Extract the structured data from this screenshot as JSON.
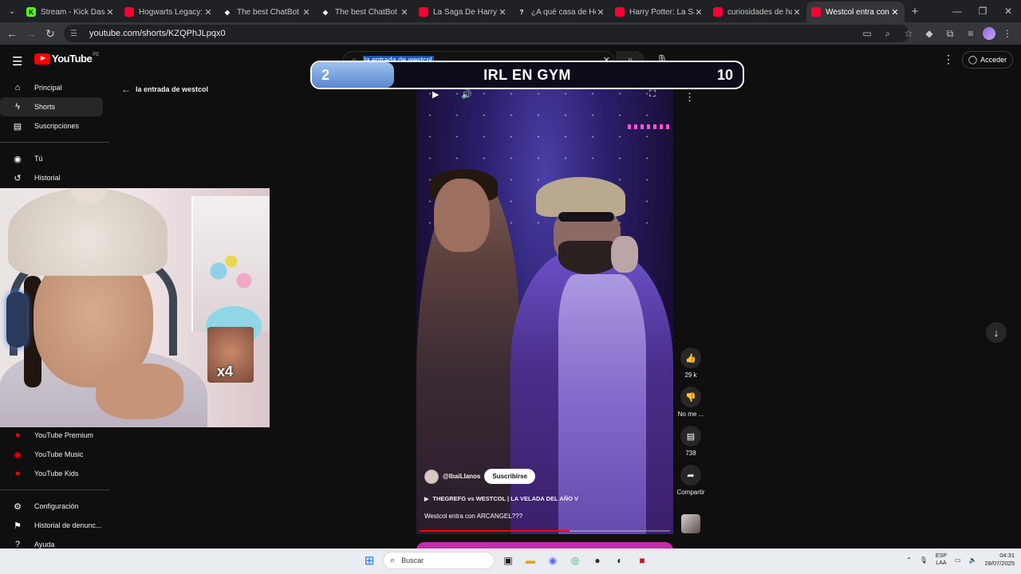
{
  "tabs": [
    {
      "title": "Stream - Kick Dashbo",
      "fav": "K",
      "favColor": "#53fc18",
      "favText": "#000"
    },
    {
      "title": "Hogwarts Legacy: ¿Va",
      "fav": "",
      "favColor": "#ff0033",
      "favText": "#fff"
    },
    {
      "title": "The best ChatBot and",
      "fav": "◆",
      "favColor": "transparent",
      "favText": "#fff"
    },
    {
      "title": "The best ChatBot and",
      "fav": "◆",
      "favColor": "transparent",
      "favText": "#fff"
    },
    {
      "title": "La Saga De Harry Pot",
      "fav": "",
      "favColor": "#ff0033",
      "favText": "#fff"
    },
    {
      "title": "¿A qué casa de Hogw",
      "fav": "?",
      "favColor": "transparent",
      "favText": "#fff"
    },
    {
      "title": "Harry Potter: La Saga",
      "fav": "",
      "favColor": "#ff0033",
      "favText": "#fff"
    },
    {
      "title": "curiosidades de harry",
      "fav": "",
      "favColor": "#ff0033",
      "favText": "#fff"
    },
    {
      "title": "Westcol entra con AR",
      "fav": "",
      "favColor": "#ff0033",
      "favText": "#fff"
    }
  ],
  "url": "youtube.com/shorts/KZQPhJLpqx0",
  "yt": {
    "wordmark": "YouTube",
    "country": "PE",
    "search_text": "la entrada de westcol",
    "acceder": "Acceder",
    "back_label": "la entrada de westcol"
  },
  "sidebar": {
    "main": [
      {
        "label": "Principal",
        "icon": "⌂"
      },
      {
        "label": "Shorts",
        "icon": "ϟ"
      },
      {
        "label": "Suscripciones",
        "icon": "▤"
      }
    ],
    "you": [
      {
        "label": "Tú",
        "icon": "◉"
      },
      {
        "label": "Historial",
        "icon": "↺"
      }
    ],
    "more": [
      {
        "label": "YouTube Premium",
        "icon": "●"
      },
      {
        "label": "YouTube Music",
        "icon": "◉"
      },
      {
        "label": "YouTube Kids",
        "icon": "●"
      }
    ],
    "settings": [
      {
        "label": "Configuración",
        "icon": "⚙"
      },
      {
        "label": "Historial de denunc...",
        "icon": "⚑"
      },
      {
        "label": "Ayuda",
        "icon": "?"
      }
    ]
  },
  "overlay": {
    "left": "2",
    "center": "IRL EN GYM",
    "right": "10",
    "progress": 0.19
  },
  "short": {
    "channel": "@IbaiLlanos",
    "subscribe": "Suscribirse",
    "playlist": "THEGREFG vs WESTCOL | LA VELADA DEL AÑO V",
    "title": "Westcol entra con ARCANGEL???",
    "progress": 0.6
  },
  "actions": {
    "likes": "29 k",
    "dislike": "No me ...",
    "comments": "738",
    "share": "Compartir"
  },
  "cam": {
    "badge": "x4"
  },
  "taskbar": {
    "search": "Buscar",
    "lang1": "ESP",
    "lang2": "LAA",
    "time": "04:31",
    "date": "28/07/2025"
  }
}
